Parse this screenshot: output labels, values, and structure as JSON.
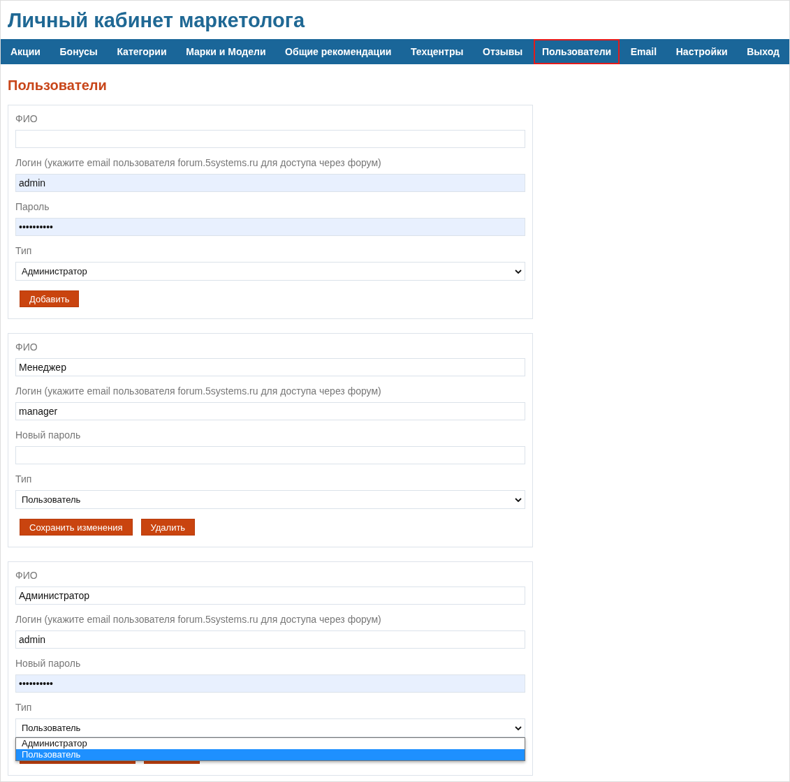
{
  "site_title": "Личный кабинет маркетолога",
  "nav": [
    {
      "label": "Акции",
      "selected": false
    },
    {
      "label": "Бонусы",
      "selected": false
    },
    {
      "label": "Категории",
      "selected": false
    },
    {
      "label": "Марки и Модели",
      "selected": false
    },
    {
      "label": "Общие рекомендации",
      "selected": false
    },
    {
      "label": "Техцентры",
      "selected": false
    },
    {
      "label": "Отзывы",
      "selected": false
    },
    {
      "label": "Пользователи",
      "selected": true
    },
    {
      "label": "Email",
      "selected": false
    },
    {
      "label": "Настройки",
      "selected": false
    },
    {
      "label": "Выход",
      "selected": false
    }
  ],
  "heading": "Пользователи",
  "forms": [
    {
      "fields": [
        {
          "kind": "text",
          "label": "ФИО",
          "autofilled": false
        },
        {
          "kind": "text",
          "label": "Логин (укажите email пользователя forum.5systems.ru для доступа через форум)",
          "value": "admin",
          "autofilled": true
        },
        {
          "kind": "text",
          "label": "Пароль",
          "value": "••••••••••",
          "autofilled": true
        },
        {
          "kind": "select",
          "label": "Тип",
          "value": "Администратор"
        }
      ],
      "buttons": [
        {
          "kind": "add",
          "label": "Добавить"
        }
      ]
    },
    {
      "fields": [
        {
          "kind": "text",
          "label": "ФИО",
          "value": "Менеджер",
          "autofilled": false
        },
        {
          "kind": "text",
          "label": "Логин (укажите email пользователя forum.5systems.ru для доступа через форум)",
          "value": "manager",
          "autofilled": false
        },
        {
          "kind": "text",
          "label": "Новый пароль",
          "autofilled": false
        },
        {
          "kind": "select",
          "label": "Тип",
          "value": "Пользователь"
        }
      ],
      "buttons": [
        {
          "kind": "save",
          "label": "Сохранить изменения"
        },
        {
          "kind": "delete",
          "label": "Удалить"
        }
      ]
    },
    {
      "fields": [
        {
          "kind": "text",
          "label": "ФИО",
          "value": "Администратор",
          "autofilled": false
        },
        {
          "kind": "text",
          "label": "Логин (укажите email пользователя forum.5systems.ru для доступа через форум)",
          "value": "admin",
          "autofilled": false
        },
        {
          "kind": "text",
          "label": "Новый пароль",
          "value": "••••••••••",
          "autofilled": true
        },
        {
          "kind": "select",
          "label": "Тип",
          "value": "Пользователь",
          "open": true,
          "options": [
            {
              "label": "Администратор",
              "selected": false
            },
            {
              "label": "Пользователь",
              "selected": true
            }
          ]
        }
      ],
      "buttons": [
        {
          "kind": "save"
        },
        {
          "kind": "delete"
        }
      ]
    }
  ]
}
